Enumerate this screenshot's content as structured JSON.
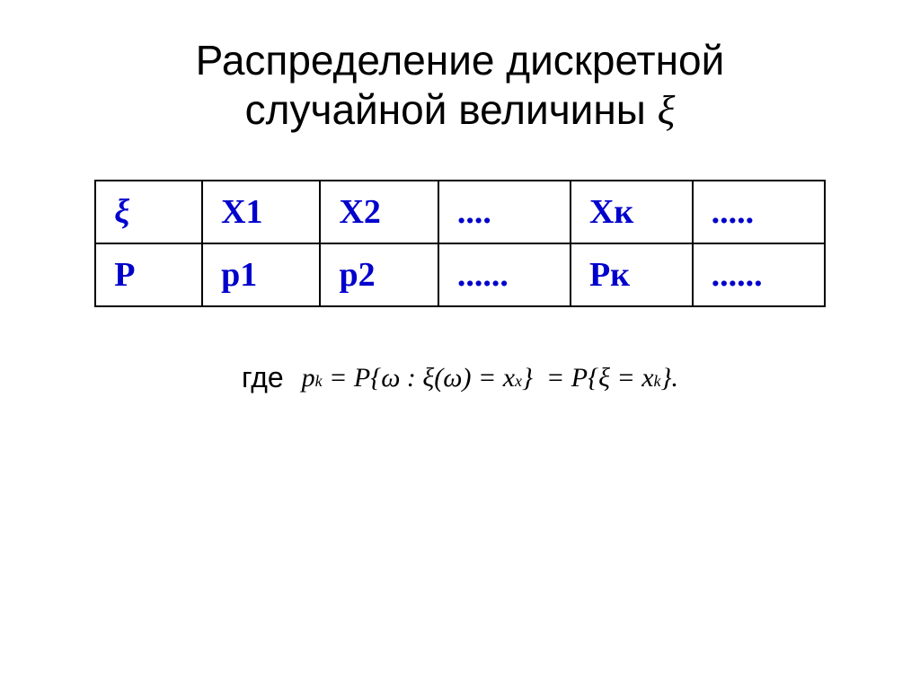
{
  "title": {
    "line1": "Распределение дискретной",
    "line2": "случайной величины",
    "xi_symbol": "ξ"
  },
  "table": {
    "row1": {
      "col1": "ξ",
      "col2": "X1",
      "col3": "X2",
      "col4": "....",
      "col5": "Xк",
      "col6": "....."
    },
    "row2": {
      "col1": "P",
      "col2": "p1",
      "col3": "p2",
      "col4": "......",
      "col5": "Рк",
      "col6": "......"
    }
  },
  "formula": {
    "label": "где",
    "expression": "p_k = P{ω : ξ(ω) = x_x} = P{ξ = x_k}."
  }
}
